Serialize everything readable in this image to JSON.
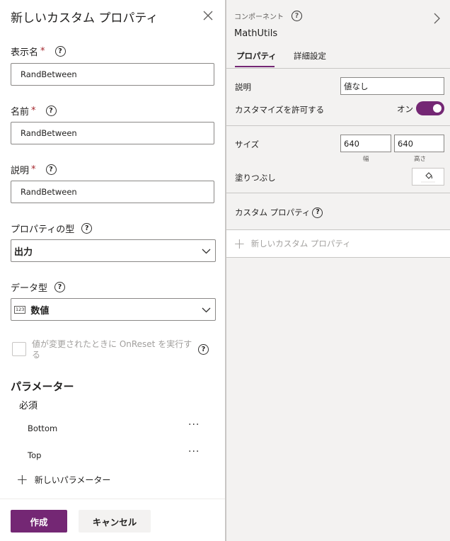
{
  "dialog": {
    "title": "新しいカスタム プロパティ",
    "display_name": {
      "label": "表示名",
      "required": "*",
      "value": "RandBetween"
    },
    "name": {
      "label": "名前",
      "required": "*",
      "value": "RandBetween"
    },
    "description": {
      "label": "説明",
      "required": "*",
      "value": "RandBetween"
    },
    "property_type": {
      "label": "プロパティの型",
      "selected": "出力"
    },
    "data_type": {
      "label": "データ型",
      "type_icon": "123",
      "selected": "数値"
    },
    "on_reset": {
      "label": "値が変更されたときに OnReset を実行する",
      "checked": false
    },
    "parameters": {
      "heading": "パラメーター",
      "required_heading": "必須",
      "items": [
        {
          "name": "Bottom"
        },
        {
          "name": "Top"
        }
      ],
      "more": "···",
      "new_label": "新しいパラメーター"
    },
    "create_label": "作成",
    "cancel_label": "キャンセル"
  },
  "help_glyph": "?",
  "component": {
    "label": "コンポーネント",
    "name": "MathUtils",
    "tabs": [
      {
        "label": "プロパティ",
        "active": true
      },
      {
        "label": "詳細設定",
        "active": false
      }
    ],
    "description": {
      "label": "説明",
      "value": "値なし"
    },
    "customize": {
      "label": "カスタマイズを許可する",
      "state": "オン",
      "on": true
    },
    "size": {
      "label": "サイズ",
      "width": "640",
      "height": "640",
      "width_caption": "幅",
      "height_caption": "高さ"
    },
    "fill": {
      "label": "塗りつぶし"
    },
    "custom_properties": {
      "label": "カスタム プロパティ",
      "new_label": "新しいカスタム プロパティ"
    }
  },
  "colors": {
    "accent": "#742774",
    "required": "#a4262c",
    "panel_bg": "#f3f2f1"
  }
}
